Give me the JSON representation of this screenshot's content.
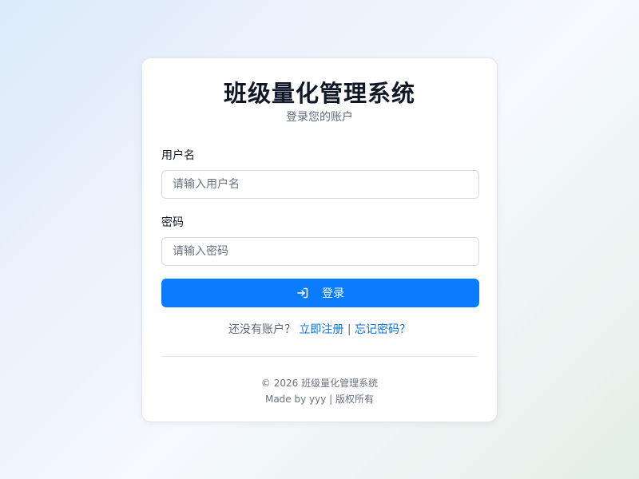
{
  "app": {
    "title": "班级量化管理系统",
    "subtitle": "登录您的账户"
  },
  "form": {
    "username": {
      "label": "用户名",
      "placeholder": "请输入用户名",
      "value": ""
    },
    "password": {
      "label": "密码",
      "placeholder": "请输入密码",
      "value": ""
    },
    "login_button": {
      "label": "登录",
      "icon": "login-icon"
    }
  },
  "links": {
    "no_account_text": "还没有账户？",
    "register": "立即注册",
    "separator": "|",
    "forgot": "忘记密码？"
  },
  "footer": {
    "copyright": "© 2026 班级量化管理系统",
    "made_by": "Made by yyy | 版权所有"
  },
  "colors": {
    "primary": "#0a7cff",
    "link": "#0a72e0",
    "title": "#101828"
  }
}
